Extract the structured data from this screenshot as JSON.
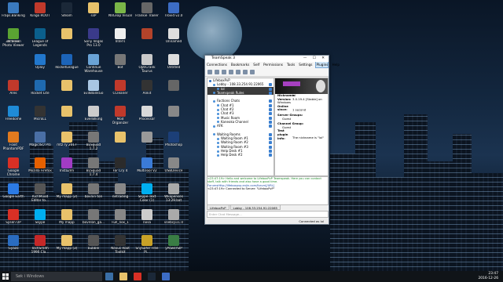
{
  "desktop_icons": [
    {
      "label": "Fraps.Banking",
      "col": 0,
      "row": 0,
      "color": "#3a7abf"
    },
    {
      "label": "Kingo ROOT",
      "col": 1,
      "row": 0,
      "color": "#c0392b"
    },
    {
      "label": "Steam",
      "col": 2,
      "row": 0,
      "color": "#1b2838"
    },
    {
      "label": "ssP",
      "col": 3,
      "row": 0,
      "color": "#e8c26b"
    },
    {
      "label": "NVLeap Visual",
      "col": 4,
      "row": 0,
      "color": "#7ab648"
    },
    {
      "label": "Frankie Trailer",
      "col": 5,
      "row": 0,
      "color": "#666"
    },
    {
      "label": "Trovid v2.0",
      "col": 6,
      "row": 0,
      "color": "#3c6cc4"
    },
    {
      "label": "Actions",
      "col": 0,
      "row": 1,
      "color": "#444"
    },
    {
      "label": "League of Legends",
      "col": 1,
      "row": 1,
      "color": "#0b5f8c"
    },
    {
      "label": "",
      "col": 2,
      "row": 1,
      "color": "#e8c26b"
    },
    {
      "label": "Sony Vegas Pro 13.0",
      "col": 3,
      "row": 1,
      "color": "#3a3a8a"
    },
    {
      "label": "Intel's",
      "col": 4,
      "row": 1,
      "color": "#eee"
    },
    {
      "label": "",
      "col": 5,
      "row": 1,
      "color": "#b3432a"
    },
    {
      "label": "Unnamed",
      "col": 6,
      "row": 1,
      "color": "#ddd"
    },
    {
      "label": "3D Vision Photo Viewer",
      "col": 0,
      "row": 1.3,
      "color": "#5aa332"
    },
    {
      "label": "Uplay",
      "col": 1,
      "row": 2,
      "color": "#2277cc"
    },
    {
      "label": "RocketLeague",
      "col": 2,
      "row": 2,
      "color": "#1c64b9"
    },
    {
      "label": "Continue Warehouse",
      "col": 3,
      "row": 2,
      "color": "#6aa3d6"
    },
    {
      "label": "Bot",
      "col": 4,
      "row": 2,
      "color": "#777"
    },
    {
      "label": "OptiCrank Taurus",
      "col": 5,
      "row": 2,
      "color": "#c9c9c9"
    },
    {
      "label": "Untitled",
      "col": 6,
      "row": 2,
      "color": "#ddd"
    },
    {
      "label": "Ares",
      "col": 0,
      "row": 3,
      "color": "#c0392b"
    },
    {
      "label": "Rocket Lite",
      "col": 1,
      "row": 3,
      "color": "#1f6ab0"
    },
    {
      "label": "",
      "col": 2,
      "row": 3,
      "color": "#e8c26b"
    },
    {
      "label": "EvilBlankGo",
      "col": 3,
      "row": 3,
      "color": "#a9c6e3"
    },
    {
      "label": "CCleaner",
      "col": 4,
      "row": 3,
      "color": "#c0392b"
    },
    {
      "label": "Ankit",
      "col": 5,
      "row": 3,
      "color": "#333"
    },
    {
      "label": "",
      "col": 6,
      "row": 3,
      "color": "#666"
    },
    {
      "label": "Freedome",
      "col": 0,
      "row": 4,
      "color": "#1f8bd6"
    },
    {
      "label": "MicroLL",
      "col": 1,
      "row": 4,
      "color": "#333"
    },
    {
      "label": "",
      "col": 2,
      "row": 4,
      "color": "#e8c26b"
    },
    {
      "label": "EverBlking",
      "col": 3,
      "row": 4,
      "color": "#ccc"
    },
    {
      "label": "Mod Organizer",
      "col": 4,
      "row": 4,
      "color": "#c0392b"
    },
    {
      "label": "Processor",
      "col": 5,
      "row": 4,
      "color": "#d9d9d9"
    },
    {
      "label": "",
      "col": 6,
      "row": 4,
      "color": "#888"
    },
    {
      "label": "Foxit PhantomPDF",
      "col": 0,
      "row": 5,
      "color": "#e07a1f"
    },
    {
      "label": "MagicISO Pro",
      "col": 1,
      "row": 5,
      "color": "#4a6fa5"
    },
    {
      "label": "mtz ry 2017",
      "col": 2,
      "row": 5,
      "color": "#e8c26b"
    },
    {
      "label": "BLSquad 1.7.2",
      "col": 3,
      "row": 5,
      "color": "#777"
    },
    {
      "label": "",
      "col": 4,
      "row": 5,
      "color": "#e8c26b"
    },
    {
      "label": "",
      "col": 5,
      "row": 5,
      "color": "#999"
    },
    {
      "label": "Photoshop",
      "col": 6,
      "row": 5,
      "color": "#1c3f78"
    },
    {
      "label": "Google Chrome",
      "col": 0,
      "row": 6,
      "color": "#d93025"
    },
    {
      "label": "Mozilla Firefox",
      "col": 1,
      "row": 6,
      "color": "#e66000"
    },
    {
      "label": "Insta2Im",
      "col": 2,
      "row": 6,
      "color": "#a23cc4"
    },
    {
      "label": "BLSquad 1.7.4",
      "col": 3,
      "row": 6,
      "color": "#777"
    },
    {
      "label": "Far Cry 4",
      "col": 4,
      "row": 6,
      "color": "#2b2b2b"
    },
    {
      "label": "MultiTool V2",
      "col": 5,
      "row": 6,
      "color": "#3b7bd6"
    },
    {
      "label": "USBDevice",
      "col": 6,
      "row": 6,
      "color": "#888"
    },
    {
      "label": "Google Earth",
      "col": 0,
      "row": 7,
      "color": "#2c7be5"
    },
    {
      "label": "RichMood Editor to...",
      "col": 1,
      "row": 7,
      "color": "#555"
    },
    {
      "label": "My mapp (2)",
      "col": 2,
      "row": 7,
      "color": "#e8c26b"
    },
    {
      "label": "bovnin ton",
      "col": 3,
      "row": 7,
      "color": "#777"
    },
    {
      "label": "netrading",
      "col": 4,
      "row": 7,
      "color": "#888"
    },
    {
      "label": "Skype Text Color (1)",
      "col": 5,
      "row": 7,
      "color": "#00aff0"
    },
    {
      "label": "Wkxpenses 13:29.bat",
      "col": 6,
      "row": 7,
      "color": "#aaa"
    },
    {
      "label": "Sysen UP",
      "col": 0,
      "row": 8,
      "color": "#d93025"
    },
    {
      "label": "Skype",
      "col": 1,
      "row": 8,
      "color": "#00aff0"
    },
    {
      "label": "My mapp",
      "col": 2,
      "row": 8,
      "color": "#e8c26b"
    },
    {
      "label": "bovnlon_ga...",
      "col": 3,
      "row": 8,
      "color": "#777"
    },
    {
      "label": "Full_nox_1",
      "col": 4,
      "row": 8,
      "color": "#888"
    },
    {
      "label": "nosa",
      "col": 5,
      "row": 8,
      "color": "#ccc"
    },
    {
      "label": "vsebcp11.0",
      "col": 6,
      "row": 8,
      "color": "#aaa"
    },
    {
      "label": "Gyazo",
      "col": 0,
      "row": 9,
      "color": "#2a6cc0"
    },
    {
      "label": "TechSmith 1990 Cla...",
      "col": 1,
      "row": 9,
      "color": "#c62828"
    },
    {
      "label": "My mapp (3)",
      "col": 2,
      "row": 9,
      "color": "#e8c26b"
    },
    {
      "label": "bubble",
      "col": 3,
      "row": 9,
      "color": "#555"
    },
    {
      "label": "Nexus Root Toolkit",
      "col": 4,
      "row": 9,
      "color": "#333"
    },
    {
      "label": "SnySafer Free Pi...",
      "col": 5,
      "row": 9,
      "color": "#c9a227"
    },
    {
      "label": "yPowerSIP",
      "col": 6,
      "row": 9,
      "color": "#3a7d44"
    }
  ],
  "taskbar": {
    "search_placeholder": "Søk i Windows",
    "time": "23:47",
    "date": "2016-12-26"
  },
  "teamspeak": {
    "title": "TeamSpeak 3",
    "menu": [
      "Connections",
      "Bookmarks",
      "Self",
      "Permissions",
      "Tools",
      "Settings",
      "Plugins",
      "Help"
    ],
    "active_menu": "Plugins",
    "tree": [
      {
        "text": "LifeboxPvP",
        "indent": 0,
        "type": "server"
      },
      {
        "text": "Lobby - 108.33.254.91:22065",
        "indent": 1,
        "type": "channel"
      },
      {
        "text": "lol",
        "indent": 2,
        "type": "user",
        "selected": true
      },
      {
        "text": "Teamspeak Rules",
        "indent": 1,
        "type": "channel",
        "selected": true
      },
      {
        "text": "",
        "indent": 1,
        "type": "spacer"
      },
      {
        "text": "Factions Chats",
        "indent": 1,
        "type": "channel"
      },
      {
        "text": "Chat #1",
        "indent": 2,
        "type": "channel"
      },
      {
        "text": "Chat #2",
        "indent": 2,
        "type": "channel"
      },
      {
        "text": "Chat #3",
        "indent": 2,
        "type": "channel"
      },
      {
        "text": "Music Room",
        "indent": 2,
        "type": "channel"
      },
      {
        "text": "Kaneoka Channel",
        "indent": 2,
        "type": "channel"
      },
      {
        "text": "AFK",
        "indent": 1,
        "type": "channel"
      },
      {
        "text": "",
        "indent": 1,
        "type": "spacer"
      },
      {
        "text": "Waiting Rooms",
        "indent": 1,
        "type": "channel"
      },
      {
        "text": "Waiting Room #1",
        "indent": 2,
        "type": "channel"
      },
      {
        "text": "Waiting Room #2",
        "indent": 2,
        "type": "channel"
      },
      {
        "text": "Waiting Room #3",
        "indent": 2,
        "type": "channel"
      },
      {
        "text": "Help Desk #1",
        "indent": 2,
        "type": "channel"
      },
      {
        "text": "Help Desk #2",
        "indent": 2,
        "type": "channel"
      }
    ],
    "info": {
      "nickname_label": "Nickname:",
      "nickname": "lol",
      "version_label": "Version:",
      "version": "3.0.19.4 [Stable] on Windows",
      "online_label": "Online since:",
      "online": "1 second",
      "server_groups_label": "Server Groups:",
      "server_group": "Guest",
      "channel_group_label": "Channel Group:",
      "channel_group": "Guest",
      "test_label": "Test plugin info:",
      "test_value": "The nickname is \"lol\""
    },
    "chat": [
      {
        "cls": "g",
        "text": "<23:47:19> Hello and welcome to LifeboxPvP Teamspeak. Here you can contact staff, talk with friends and also have a good time."
      },
      {
        "cls": "b",
        "text": "ForumsHttp://lifeboxpvp.enjin.com/forum[/URL]"
      },
      {
        "cls": "",
        "text": "<23:47:19> Connected to Server: \"LifeboxPvP\""
      }
    ],
    "tabs": [
      "LifeboxPvP",
      "Lobby - 108.33.254.91:22065"
    ],
    "input_placeholder": "Enter Chat Message...",
    "status_right": "Connected as lol"
  }
}
